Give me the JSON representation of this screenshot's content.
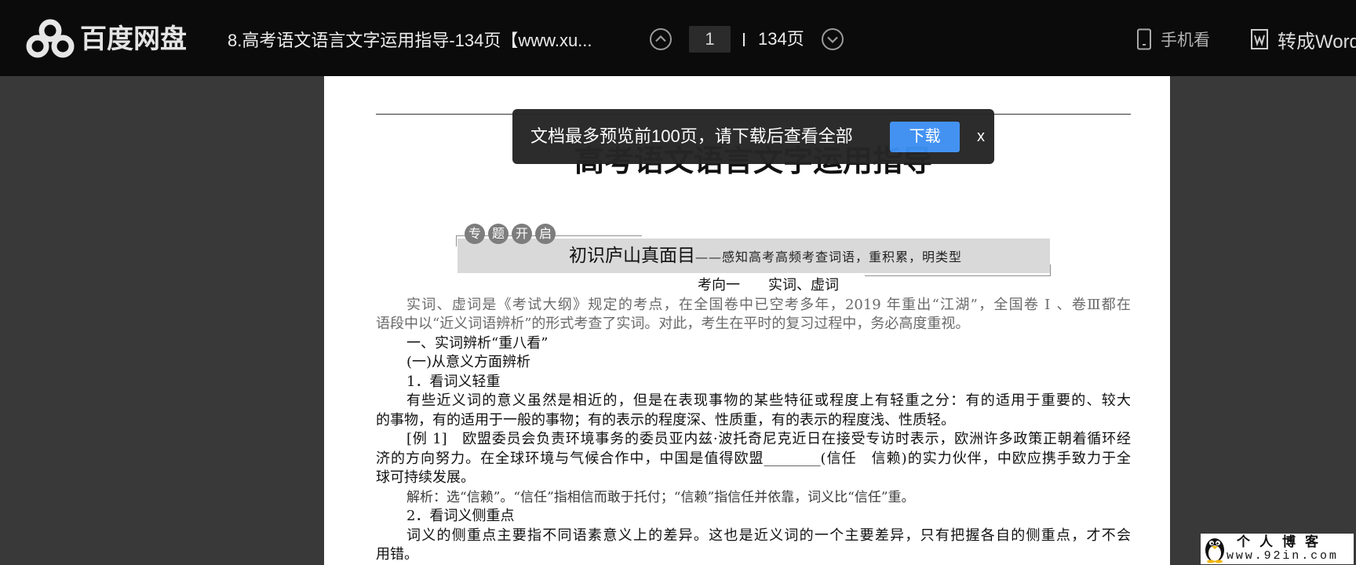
{
  "colors": {
    "topbar_bg": "#0b0b0b",
    "viewer_bg": "#393939",
    "toast_bg": "#262626",
    "accent": "#3d8ff2"
  },
  "topbar": {
    "logo": {
      "icon": "baidu-netdisk-cloud-icon",
      "text": "百度网盘"
    },
    "doc_title": "8.高考语文语言文字运用指导-134页【www.xu...",
    "pager": {
      "prev_icon": "chevron-up-circle-icon",
      "current_page": "1",
      "total": "134页",
      "next_icon": "chevron-down-circle-icon"
    },
    "actions": [
      {
        "icon": "phone-icon",
        "label": "手机看"
      },
      {
        "icon": "word-doc-icon",
        "label": "转成Word"
      }
    ]
  },
  "toast": {
    "message": "文档最多预览前100页，请下载后查看全部",
    "download_label": "下载",
    "close_label": "x"
  },
  "document": {
    "title": "高考语文语言文字运用指导",
    "badge": [
      "专",
      "题",
      "开",
      "启"
    ],
    "banner": {
      "main": "初识庐山真面目",
      "sub": "——感知高考高频考查词语，重积累，明类型"
    },
    "section_heading": "考向一　　实词、虚词",
    "lines": [
      "实词、虚词是《考试大纲》规定的考点，在全国卷中已空考多年，2019 年重出“江湖”，全国卷 Ⅰ 、卷Ⅲ都在",
      "语段中以“近义词语辨析”的形式考查了实词。对此，考生在平时的复习过程中，务必高度重视。",
      "一、实词辨析“重八看”",
      "(一)从意义方面辨析",
      "1．看词义轻重",
      "有些近义词的意义虽然是相近的，但是在表现事物的某些特征或程度上有轻重之分：有的适用于重要的、较大",
      "的事物，有的适用于一般的事物；有的表示的程度深、性质重，有的表示的程度浅、性质轻。",
      "[例 1]　欧盟委员会负责环境事务的委员亚内兹·波托奇尼克近日在接受专访时表示，欧洲许多政策正朝着循环经",
      "济的方向努力。在全球环境与气候合作中，中国是值得欧盟________(信任　信赖)的实力伙伴，中欧应携手致力于全",
      "球可持续发展。",
      "解析：选“信赖”。“信任”指相信而敢于托付；“信赖”指信任并依靠，词义比“信任”重。",
      "2．看词义侧重点",
      "词义的侧重点主要指不同语素意义上的差异。这也是近义词的一个主要差异，只有把握各自的侧重点，才不会",
      "用错。"
    ]
  },
  "watermark": {
    "icon": "penguin-icon",
    "title": "个人博客",
    "url": "www.92in.com"
  }
}
